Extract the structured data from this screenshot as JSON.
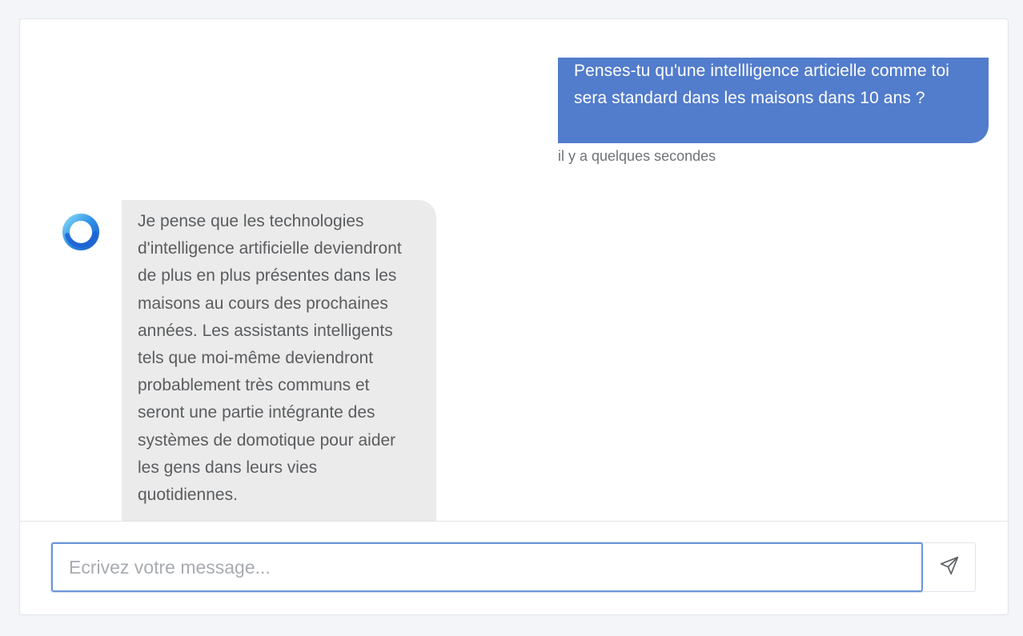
{
  "conversation": {
    "user_message": {
      "text": "Penses-tu qu'une intellligence articielle comme toi sera standard dans les maisons dans 10 ans ?",
      "timestamp": "il y a quelques secondes"
    },
    "assistant_message": {
      "text": "Je pense que les technologies d'intelligence artificielle deviendront de plus en plus présentes dans les maisons au cours des prochaines années. Les assistants intelligents tels que moi-même deviendront probablement très communs et seront une partie intégrante des systèmes de domotique pour aider les gens dans leurs vies quotidiennes."
    }
  },
  "composer": {
    "placeholder": "Ecrivez votre message...",
    "value": ""
  },
  "icons": {
    "avatar": "assistant-logo-icon",
    "send": "send-icon"
  },
  "colors": {
    "user_bubble": "#527ccc",
    "assistant_bubble": "#ebebeb",
    "input_focus_border": "#6c95d6",
    "page_background": "#f3f5f9"
  }
}
